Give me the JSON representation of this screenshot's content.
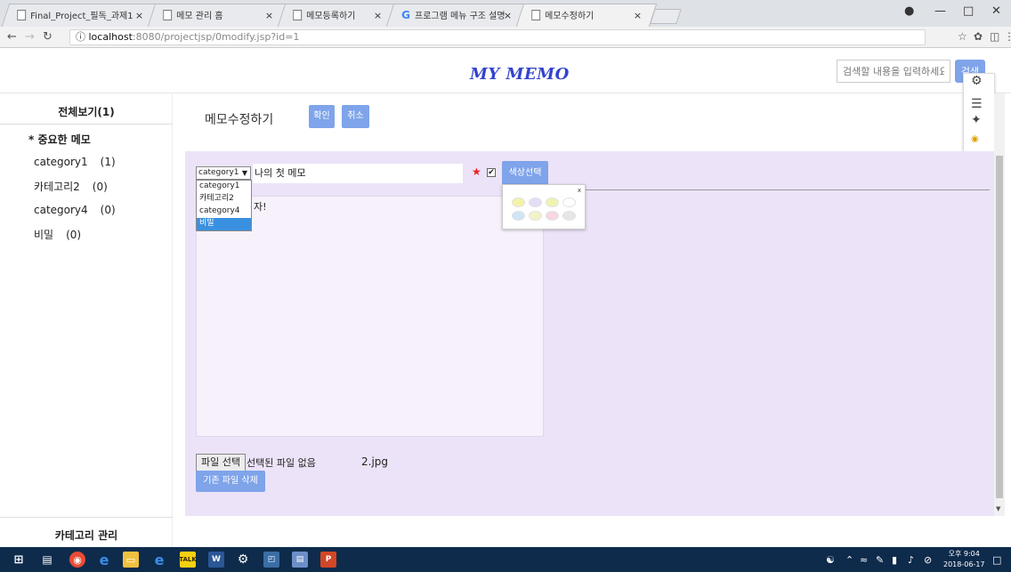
{
  "browser": {
    "tabs": [
      {
        "title": "Final_Project_필독_과제1",
        "close": "×"
      },
      {
        "title": "메모 관리 홈",
        "close": "×"
      },
      {
        "title": "메모등록하기",
        "close": "×"
      },
      {
        "title": "프로그램 메뉴 구조 설명",
        "close": "×"
      },
      {
        "title": "메모수정하기",
        "close": "×"
      }
    ],
    "url_host": "localhost",
    "url_path": ":8080/projectjsp/0modify.jsp?id=1",
    "info_icon": "ⓘ"
  },
  "header": {
    "logo": "MY MEMO",
    "search_placeholder": "검색할 내용을 입력하세요",
    "search_button": "검색"
  },
  "sidebar": {
    "title": "전체보기(1)",
    "important": "* 중요한 메모",
    "categories": [
      {
        "name": "category1",
        "count": "(1)"
      },
      {
        "name": "카테고리2",
        "count": "(0)"
      },
      {
        "name": "category4",
        "count": "(0)"
      },
      {
        "name": "비밀",
        "count": "(0)"
      }
    ],
    "manage": "카테고리 관리"
  },
  "main": {
    "title": "메모수정하기",
    "confirm_button": "확인",
    "cancel_button": "취소",
    "category_selected": "category1",
    "category_options": [
      "category1",
      "카테고리2",
      "category4",
      "비밀"
    ],
    "memo_title": "나의 첫 메모",
    "star": "★",
    "checkbox": "✔",
    "color_button": "색상선택",
    "palette_close": "x",
    "palette_colors": [
      "#f3f3a8",
      "#e4ddf5",
      "#eef3b0",
      "#ffffff",
      "#cfe6f5",
      "#f3f3c8",
      "#f7d7e2",
      "#e6e6e6"
    ],
    "content_visible": "자!",
    "file_button": "파일 선택",
    "file_none": "선택된 파일 없음",
    "file_name": "2.jpg",
    "delete_file_button": "기존 파일 삭제"
  },
  "taskbar": {
    "time": "오후 9:04",
    "date": "2018-06-17"
  }
}
